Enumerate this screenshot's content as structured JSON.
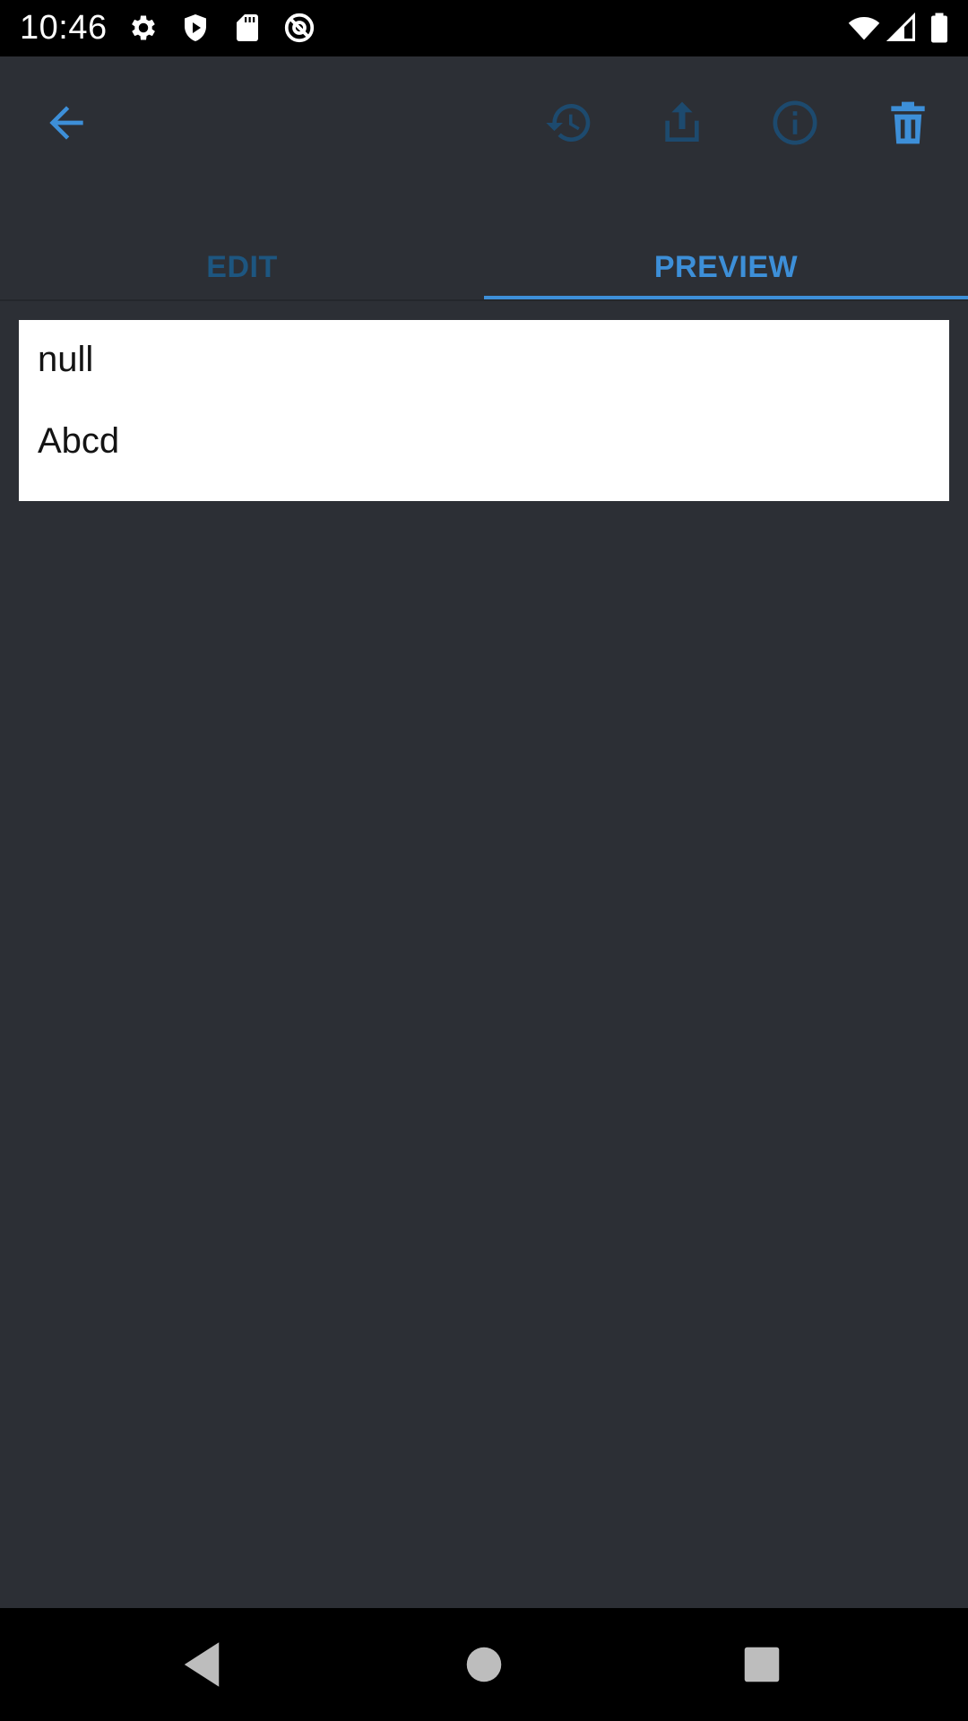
{
  "status_bar": {
    "time": "10:46",
    "icons": [
      "settings-icon",
      "shield-play-icon",
      "sd-card-icon",
      "at-sign-icon",
      "wifi-icon",
      "signal-icon",
      "battery-icon"
    ]
  },
  "toolbar": {
    "actions": [
      "back-arrow-icon",
      "history-icon",
      "share-icon",
      "info-icon",
      "delete-icon"
    ],
    "accent_color": "#3d8fd8",
    "disabled_color": "#1d4a6e"
  },
  "tabs": [
    {
      "label": "EDIT",
      "selected": false
    },
    {
      "label": "PREVIEW",
      "selected": true
    }
  ],
  "preview": {
    "lines": [
      "null",
      "Abcd"
    ]
  },
  "nav_bar": {
    "buttons": [
      "back-icon",
      "home-icon",
      "recents-icon"
    ]
  }
}
